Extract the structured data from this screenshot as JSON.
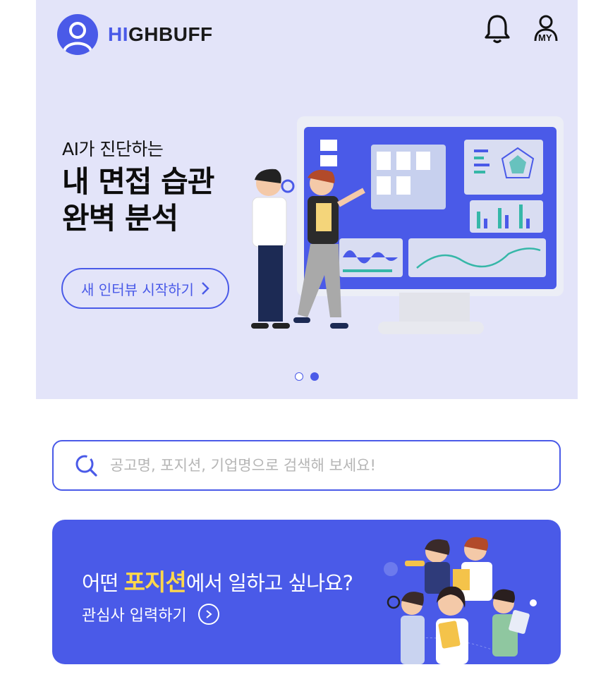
{
  "header": {
    "brand_prefix": "HI",
    "brand_suffix": "GHBUFF",
    "notification_icon": "bell-icon",
    "my_icon": "my-page-icon",
    "my_label": "MY"
  },
  "hero": {
    "subtitle": "AI가 진단하는",
    "title_line1": "내 면접 습관",
    "title_line2": "완벽 분석",
    "cta_label": "새 인터뷰 시작하기",
    "slides_total": 2,
    "slide_active": 2
  },
  "search": {
    "placeholder": "공고명, 포지션, 기업명으로 검색해 보세요!",
    "value": ""
  },
  "promo": {
    "title_before": "어떤 ",
    "title_highlight": "포지션",
    "title_after": "에서 일하고 싶나요?",
    "link_label": "관심사 입력하기"
  },
  "colors": {
    "accent": "#4a5ae8",
    "hero_bg": "#e3e4f9",
    "highlight": "#ffd84a"
  }
}
